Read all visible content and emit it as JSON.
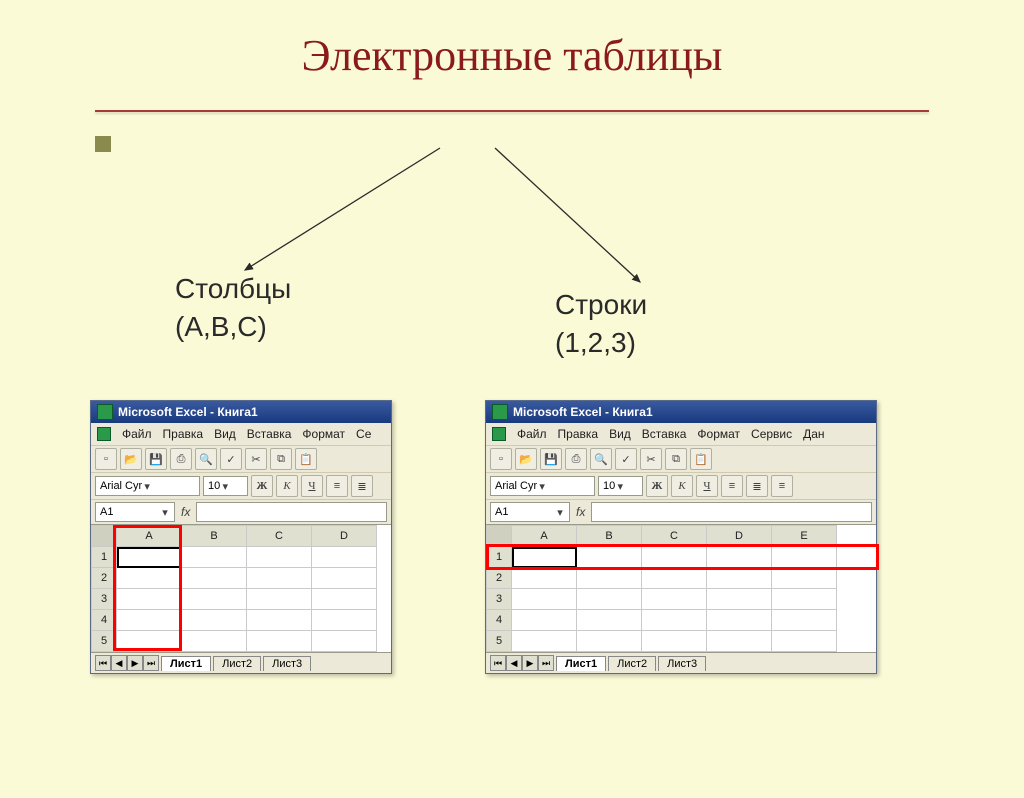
{
  "slide": {
    "title": "Электронные таблицы"
  },
  "labels": {
    "columns_line1": "Столбцы",
    "columns_line2": "(A,B,C)",
    "rows_line1": "Строки",
    "rows_line2": "(1,2,3)"
  },
  "excel": {
    "window_title": "Microsoft Excel - Книга1",
    "menu_left": [
      "Файл",
      "Правка",
      "Вид",
      "Вставка",
      "Формат",
      "Се"
    ],
    "menu_right": [
      "Файл",
      "Правка",
      "Вид",
      "Вставка",
      "Формат",
      "Сервис",
      "Дан"
    ],
    "font_name": "Arial Cyr",
    "font_size": "10",
    "fmt_bold": "Ж",
    "fmt_italic": "К",
    "fmt_underline": "Ч",
    "namebox": "A1",
    "fx_label": "fx",
    "columns_left": [
      "A",
      "B",
      "C",
      "D"
    ],
    "columns_right": [
      "A",
      "B",
      "C",
      "D",
      "E"
    ],
    "rows": [
      "1",
      "2",
      "3",
      "4",
      "5"
    ],
    "sheets": [
      "Лист1",
      "Лист2",
      "Лист3"
    ],
    "nav": [
      "⏮",
      "◀",
      "▶",
      "⏭"
    ]
  }
}
